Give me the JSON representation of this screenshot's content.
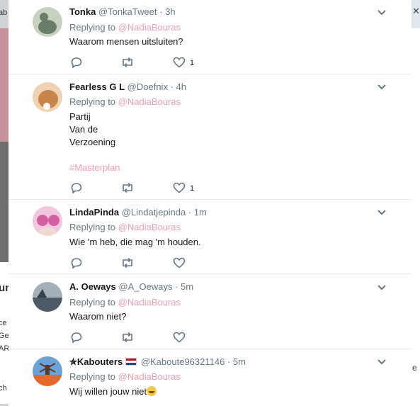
{
  "background": {
    "left_edge_fragments": [
      "ab",
      "ur",
      "ce",
      "Ge",
      "AR",
      "ch"
    ],
    "right_edge_fragment": "e"
  },
  "tweets": [
    {
      "name": "Tonka",
      "handle": "@TonkaTweet",
      "time": "· 3h",
      "replying_label": "Replying to",
      "mention": "@NadiaBouras",
      "lines": [
        "Waarom mensen uitsluiten?"
      ],
      "hashtag": "",
      "like_count": "1",
      "avatar_colors": [
        "#6a7d6a",
        "#c8d2c0"
      ]
    },
    {
      "name": "Fearless G L",
      "handle": "@Doefnix",
      "time": "· 4h",
      "replying_label": "Replying to",
      "mention": "@NadiaBouras",
      "lines": [
        "Partij",
        "Van de",
        "Verzoening"
      ],
      "hashtag": "#Masterplan",
      "like_count": "1",
      "avatar_colors": [
        "#c9844a",
        "#eed2b2"
      ]
    },
    {
      "name": "LindaPinda",
      "handle": "@Lindatjepinda",
      "time": "· 1m",
      "replying_label": "Replying to",
      "mention": "@NadiaBouras",
      "lines": [
        "Wie 'm heb, die mag 'm houden."
      ],
      "hashtag": "",
      "like_count": "",
      "avatar_colors": [
        "#d45fa0",
        "#f2c7dd"
      ]
    },
    {
      "name": "A. Oeways",
      "handle": "@A_Oeways",
      "time": "· 5m",
      "replying_label": "Replying to",
      "mention": "@NadiaBouras",
      "lines": [
        "Waarom niet?"
      ],
      "hashtag": "",
      "like_count": "",
      "avatar_colors": [
        "#4d5a66",
        "#a3b0b8"
      ]
    },
    {
      "name": "✮Kabouters",
      "handle": "@Kaboute96321146",
      "time": "· 5m",
      "replying_label": "Replying to",
      "mention": "@NadiaBouras",
      "lines": [
        "Wij willen jouw niet"
      ],
      "hashtag": "",
      "like_count": "",
      "avatar_colors": [
        "#e36a2c",
        "#6aa3d8"
      ]
    }
  ],
  "colors": {
    "mention": "#ee9fb0",
    "icon": "#657786",
    "name": "#14171a"
  },
  "icons": {
    "reply": "reply-icon",
    "retweet": "retweet-icon",
    "like": "heart-icon",
    "more": "chevron-down-icon"
  }
}
